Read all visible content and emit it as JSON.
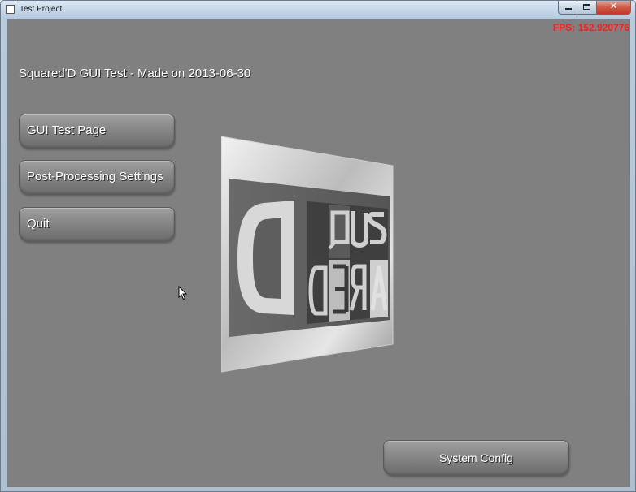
{
  "window": {
    "title": "Test Project",
    "buttons": {
      "close": "✕"
    }
  },
  "hud": {
    "fps": "FPS: 152.920776",
    "fps_color": "#ff1a1a"
  },
  "header": {
    "text": "Squared'D GUI Test - Made on 2013-06-30"
  },
  "menu": {
    "items": [
      {
        "label": "GUI Test Page"
      },
      {
        "label": "Post-Processing Settings"
      },
      {
        "label": "Quit"
      }
    ],
    "system_config": "System Config"
  },
  "scene": {
    "plane_icon": "squared-logo-texture",
    "background_color": "#808080"
  }
}
